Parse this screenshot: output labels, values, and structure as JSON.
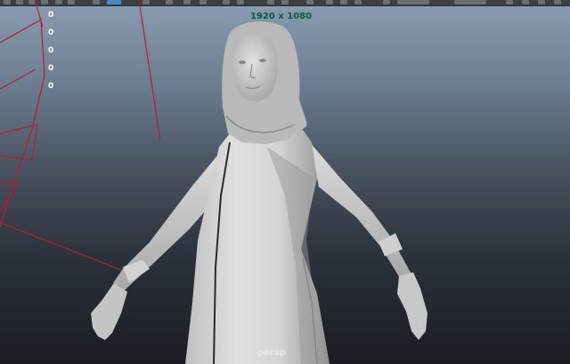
{
  "viewport": {
    "resolution_gate": "1920 x 1080",
    "camera_name": "persp",
    "hud_values": [
      "0",
      "0",
      "0",
      "0",
      "0"
    ]
  },
  "colors": {
    "curve_red": "#b3202a",
    "resolution_text": "#0b5b3b",
    "toolbar_active": "#4a8ac4"
  }
}
